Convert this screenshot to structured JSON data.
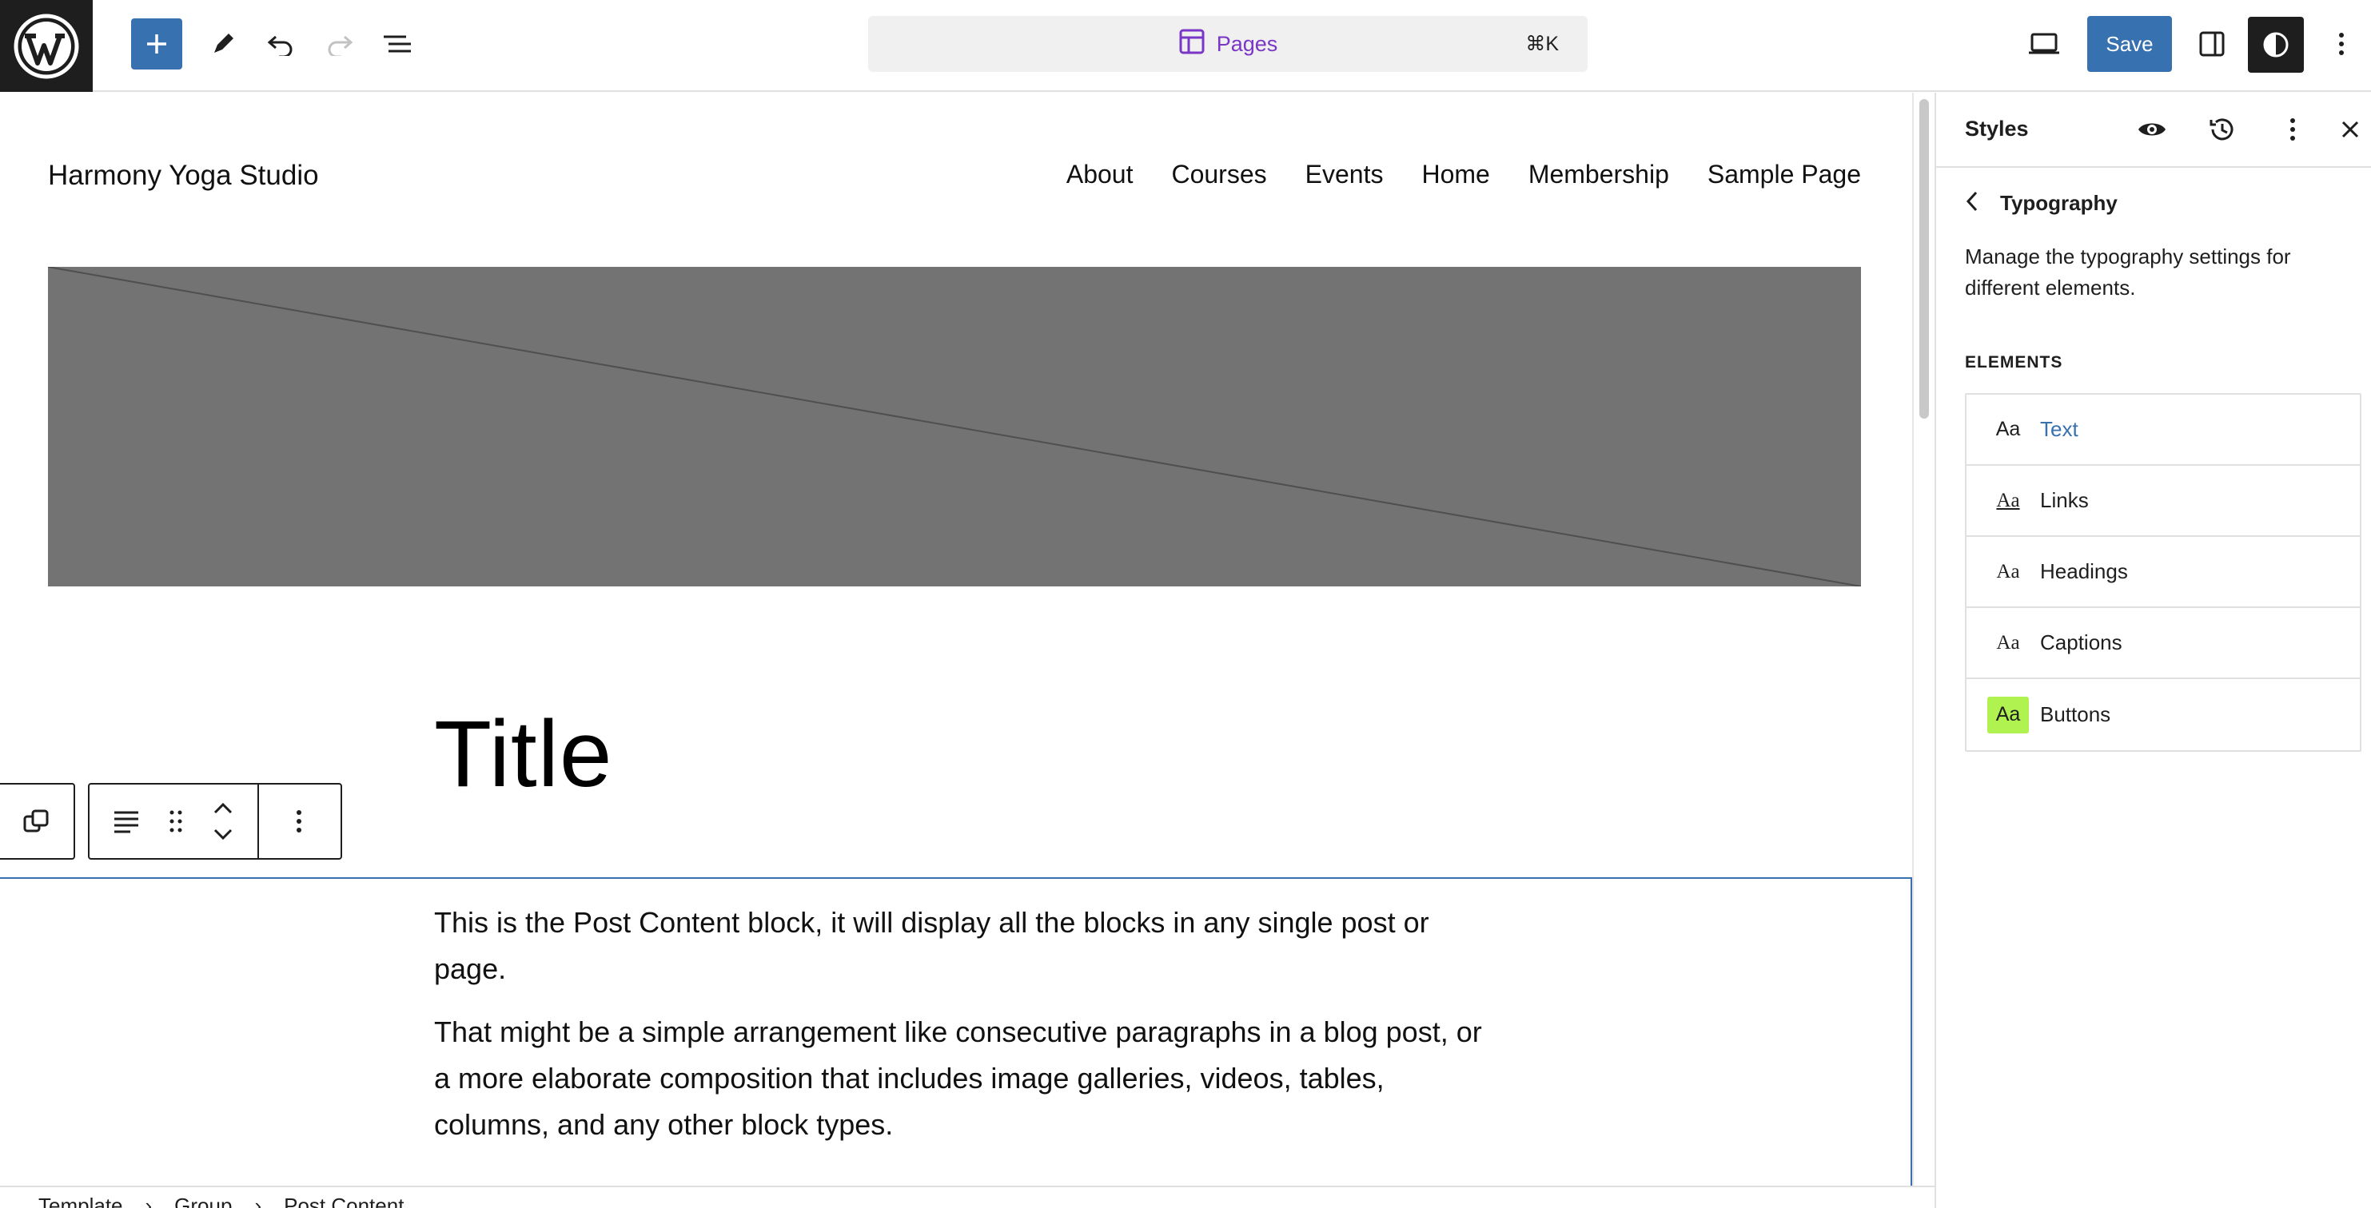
{
  "toolbar": {
    "document_title": "Pages",
    "shortcut": "⌘K",
    "save_label": "Save",
    "colors": {
      "primary": "#3871b0",
      "command_accent": "#7a36c6"
    }
  },
  "site": {
    "title": "Harmony Yoga Studio",
    "nav": [
      "About",
      "Courses",
      "Events",
      "Home",
      "Membership",
      "Sample Page"
    ]
  },
  "content": {
    "post_title": "Title",
    "paragraph_1": "This is the Post Content block, it will display all the blocks in any single post or page.",
    "paragraph_2": "That might be a simple arrangement like consecutive paragraphs in a blog post, or a more elaborate composition that includes image galleries, videos, tables, columns, and any other block types."
  },
  "breadcrumb": [
    "Template",
    "Group",
    "Post Content"
  ],
  "sidebar": {
    "title": "Styles",
    "panel_title": "Typography",
    "description": "Manage the typography settings for different elements.",
    "section_label": "ELEMENTS",
    "elements": [
      {
        "sample": "Aa",
        "label": "Text",
        "active": true
      },
      {
        "sample": "Aa",
        "label": "Links"
      },
      {
        "sample": "Aa",
        "label": "Headings"
      },
      {
        "sample": "Aa",
        "label": "Captions"
      },
      {
        "sample": "Aa",
        "label": "Buttons",
        "swatch": "#b0f250"
      }
    ]
  }
}
